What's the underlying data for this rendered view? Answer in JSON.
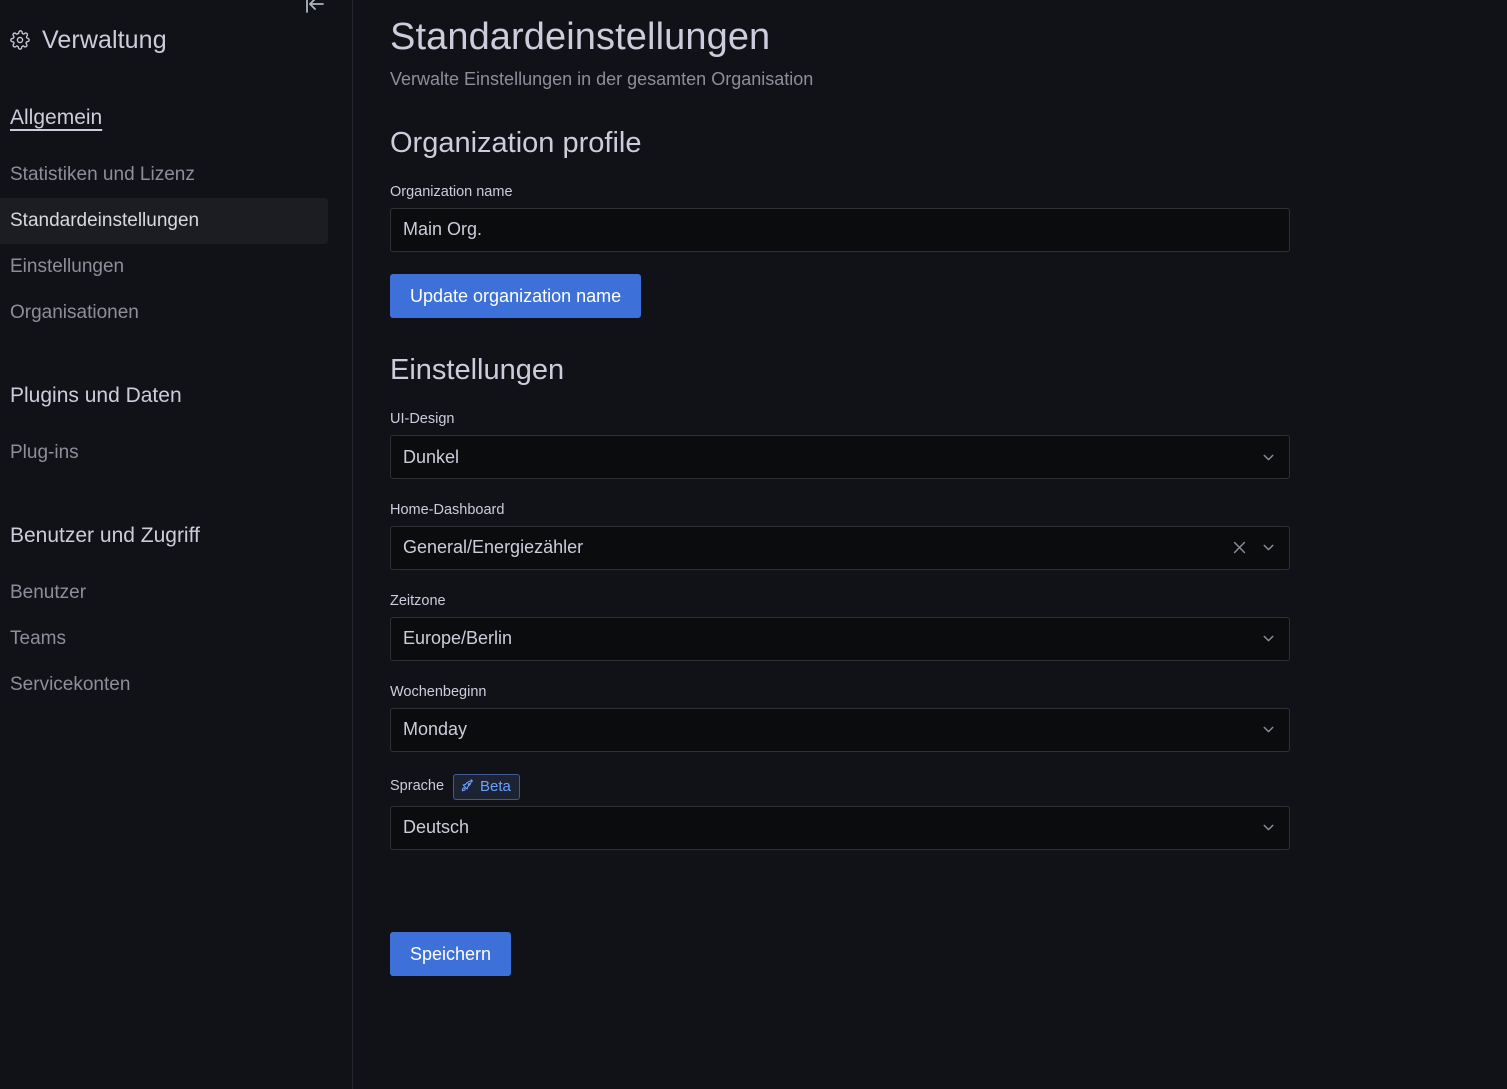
{
  "sidebar": {
    "title": "Verwaltung",
    "title_icon": "gear-icon",
    "dock_icon": "dock-menu-icon",
    "sections": [
      {
        "id": "allgemein",
        "label": "Allgemein",
        "is_link": true,
        "items": [
          {
            "id": "statistiken-und-lizenz",
            "label": "Statistiken und Lizenz",
            "active": false
          },
          {
            "id": "standardeinstellungen",
            "label": "Standardeinstellungen",
            "active": true
          },
          {
            "id": "einstellungen",
            "label": "Einstellungen",
            "active": false
          },
          {
            "id": "organisationen",
            "label": "Organisationen",
            "active": false
          }
        ]
      },
      {
        "id": "plugins-und-daten",
        "label": "Plugins und Daten",
        "is_link": false,
        "items": [
          {
            "id": "plug-ins",
            "label": "Plug-ins",
            "active": false
          }
        ]
      },
      {
        "id": "benutzer-und-zugriff",
        "label": "Benutzer und Zugriff",
        "is_link": false,
        "items": [
          {
            "id": "benutzer",
            "label": "Benutzer",
            "active": false
          },
          {
            "id": "teams",
            "label": "Teams",
            "active": false
          },
          {
            "id": "servicekonten",
            "label": "Servicekonten",
            "active": false
          }
        ]
      }
    ]
  },
  "page": {
    "title": "Standardeinstellungen",
    "subtitle": "Verwalte Einstellungen in der gesamten Organisation"
  },
  "org_profile": {
    "section_title": "Organization profile",
    "org_name_label": "Organization name",
    "org_name_value": "Main Org.",
    "org_name_placeholder": "Organization name",
    "update_button_label": "Update organization name"
  },
  "preferences": {
    "section_title": "Einstellungen",
    "fields": [
      {
        "id": "ui-design",
        "label": "UI-Design",
        "value": "Dunkel",
        "clearable": false,
        "badge": null
      },
      {
        "id": "home-dashboard",
        "label": "Home-Dashboard",
        "value": "General/Energiezähler",
        "clearable": true,
        "badge": null
      },
      {
        "id": "zeitzone",
        "label": "Zeitzone",
        "value": "Europe/Berlin",
        "clearable": false,
        "badge": null
      },
      {
        "id": "wochenbeginn",
        "label": "Wochenbeginn",
        "value": "Monday",
        "clearable": false,
        "badge": null
      },
      {
        "id": "sprache",
        "label": "Sprache",
        "value": "Deutsch",
        "clearable": false,
        "badge": {
          "label": "Beta",
          "icon": "rocket-icon"
        }
      }
    ],
    "save_button_label": "Speichern"
  },
  "colors": {
    "background": "#111217",
    "sidebar_border": "#24262e",
    "input_background": "#0b0c0e",
    "input_border": "#2e3036",
    "text_primary": "#ccccdc",
    "text_secondary": "#8e8e9b",
    "accent_blue": "#3d71d9",
    "badge_blue": "#6e9fff",
    "active_item_background": "#1c1d23"
  }
}
